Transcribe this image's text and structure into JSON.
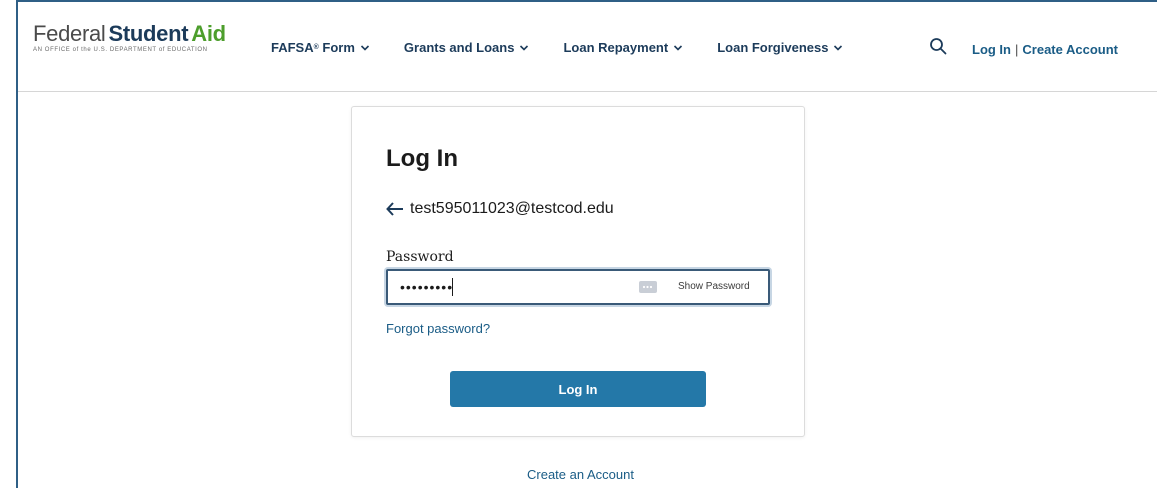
{
  "logo": {
    "federal": "Federal",
    "student": "Student",
    "aid": "Aid",
    "subtitle": "AN OFFICE of the U.S. DEPARTMENT of EDUCATION"
  },
  "nav": {
    "fafsa": "FAFSA",
    "fafsa_reg": "®",
    "fafsa_suffix": " Form",
    "grants": "Grants and Loans",
    "repayment": "Loan Repayment",
    "forgiveness": "Loan Forgiveness",
    "chevron_icon": "chevron-down-icon"
  },
  "header": {
    "search_icon": "search-icon",
    "login": "Log In",
    "separator": "|",
    "create": "Create Account"
  },
  "card": {
    "title": "Log In",
    "email": "test595011023@testcod.edu",
    "back_icon": "arrow-left-icon",
    "password_label": "Password",
    "password_value": "•••••••••",
    "key_icon": "password-manager-icon",
    "show_password": "Show Password",
    "forgot": "Forgot password?",
    "login_button": "Log In"
  },
  "footer": {
    "create_account": "Create an Account"
  },
  "colors": {
    "brand_navy": "#1c3b5a",
    "brand_green": "#4d9e2c",
    "link": "#1a5c86",
    "button": "#2478a8"
  }
}
